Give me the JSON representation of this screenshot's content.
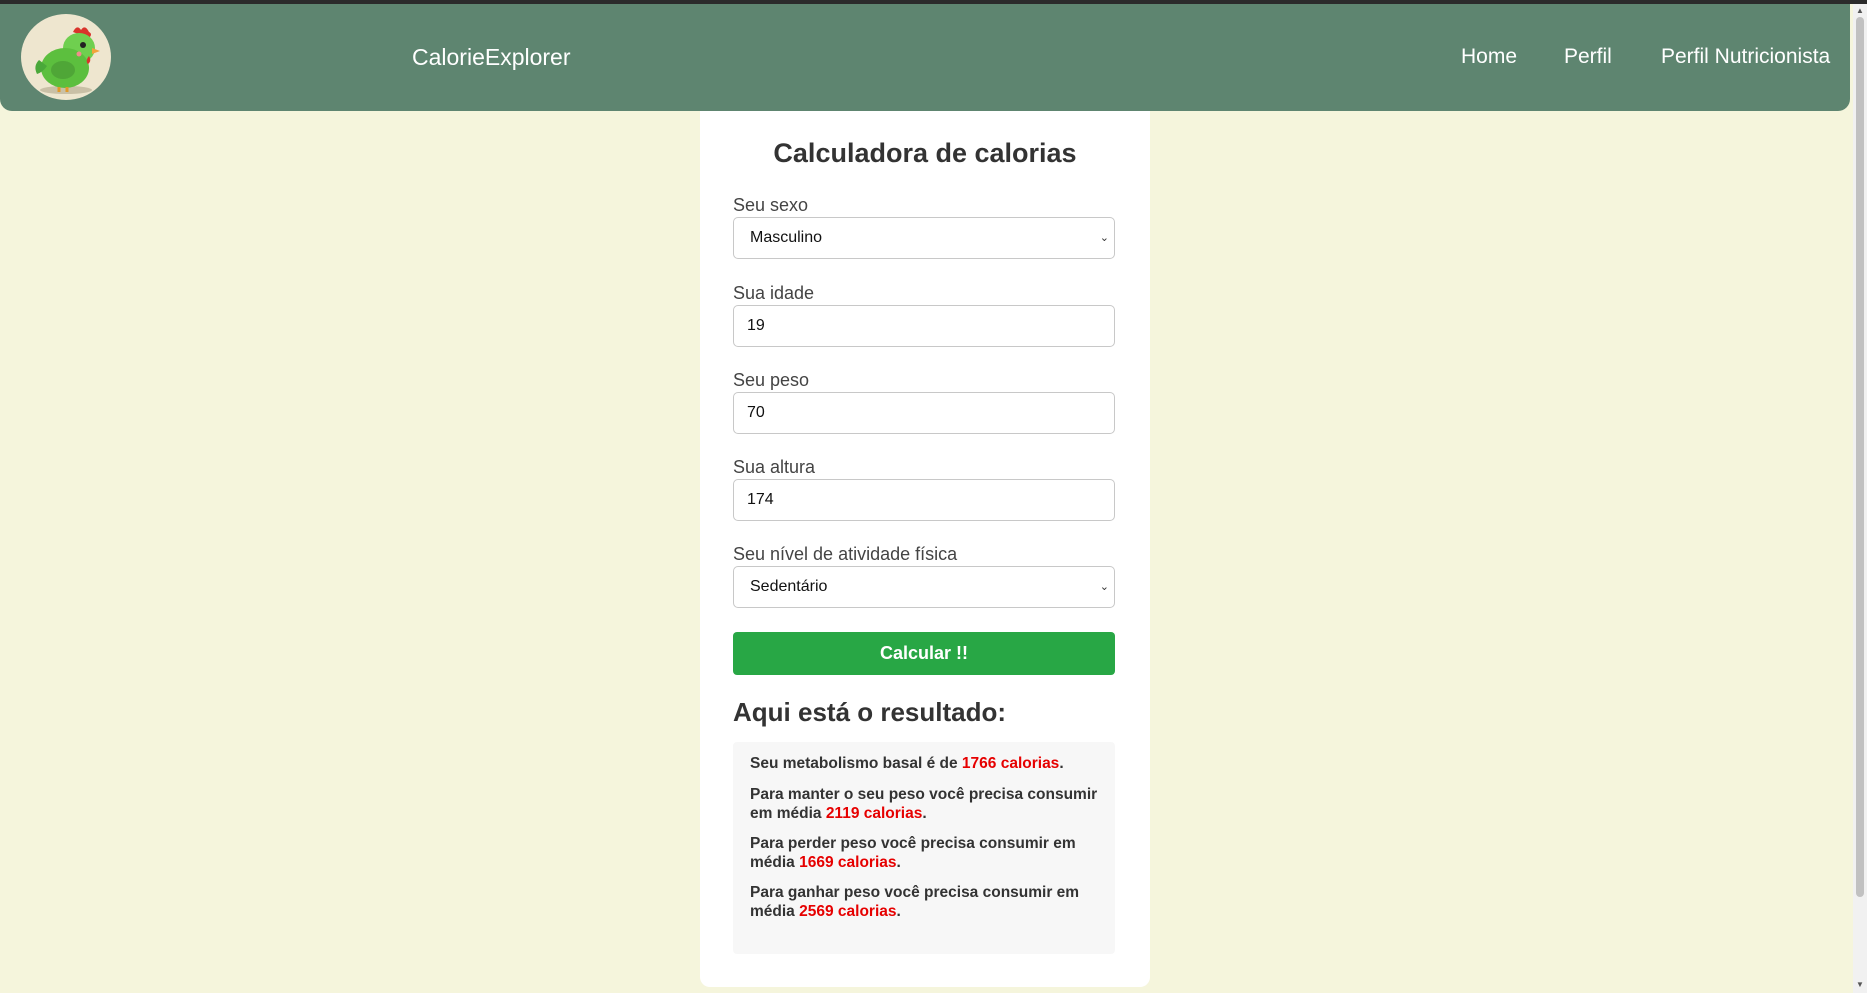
{
  "header": {
    "brand": "CalorieExplorer",
    "logo_icon": "chicken-logo-icon",
    "nav": [
      {
        "label": "Home"
      },
      {
        "label": "Perfil"
      },
      {
        "label": "Perfil Nutricionista"
      }
    ],
    "bg_color": "#5e8570"
  },
  "form": {
    "title": "Calculadora de calorias",
    "sex": {
      "label": "Seu sexo",
      "value": "Masculino"
    },
    "age": {
      "label": "Sua idade",
      "value": "19"
    },
    "weight": {
      "label": "Seu peso",
      "value": "70"
    },
    "height": {
      "label": "Sua altura",
      "value": "174"
    },
    "activity": {
      "label": "Seu nível de atividade física",
      "value": "Sedentário"
    },
    "submit_label": "Calcular !!",
    "submit_color": "#28a745"
  },
  "result": {
    "title": "Aqui está o resultado:",
    "bmr": {
      "prefix": "Seu metabolismo basal é de ",
      "value": "1766 calorias",
      "suffix": "."
    },
    "maintain": {
      "prefix": "Para manter o seu peso você precisa consumir em média ",
      "value": "2119 calorias",
      "suffix": "."
    },
    "lose": {
      "prefix": "Para perder peso você precisa consumir em média ",
      "value": "1669 calorias",
      "suffix": "."
    },
    "gain": {
      "prefix": "Para ganhar peso você precisa consumir em média ",
      "value": "2569 calorias",
      "suffix": "."
    },
    "highlight_color": "#e60000"
  }
}
